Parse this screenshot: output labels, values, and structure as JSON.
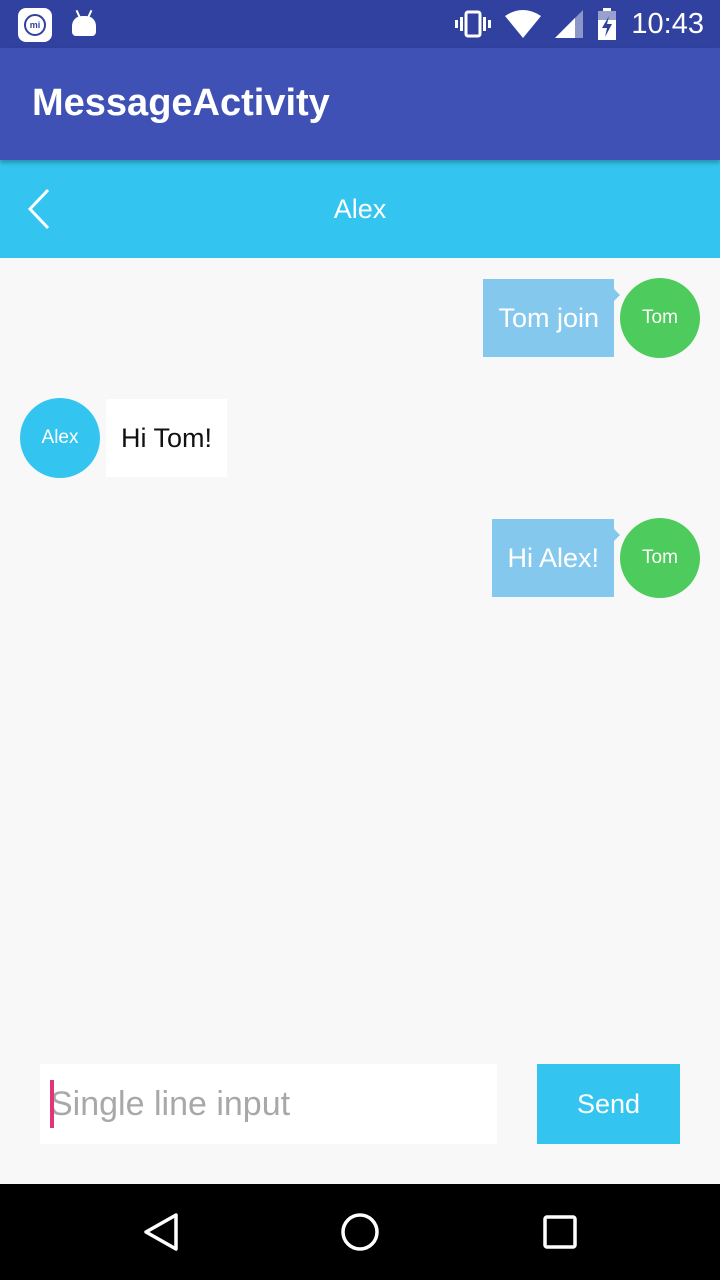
{
  "status_bar": {
    "time": "10:43",
    "icons": [
      "mi-app-icon",
      "android-icon",
      "vibrate-icon",
      "wifi-icon",
      "signal-icon",
      "battery-icon"
    ]
  },
  "app_bar": {
    "title": "MessageActivity"
  },
  "chat_header": {
    "title": "Alex",
    "back_icon": "chevron-left-icon"
  },
  "messages": [
    {
      "sender": "Tom",
      "direction": "sent",
      "text": "Tom join",
      "avatar_label": "Tom"
    },
    {
      "sender": "Alex",
      "direction": "received",
      "text": "Hi Tom!",
      "avatar_label": "Alex"
    },
    {
      "sender": "Tom",
      "direction": "sent",
      "text": "Hi Alex!",
      "avatar_label": "Tom"
    }
  ],
  "composer": {
    "placeholder": "Single line input",
    "send_label": "Send"
  },
  "nav_bar": {
    "icons": [
      "back-triangle-icon",
      "home-circle-icon",
      "recents-square-icon"
    ]
  },
  "colors": {
    "status_bar": "#3041a0",
    "app_bar": "#3f51b5",
    "accent": "#33c5f0",
    "tom_avatar": "#4dcb5c",
    "sent_bubble": "#85c8ee",
    "caret": "#e0357a"
  }
}
